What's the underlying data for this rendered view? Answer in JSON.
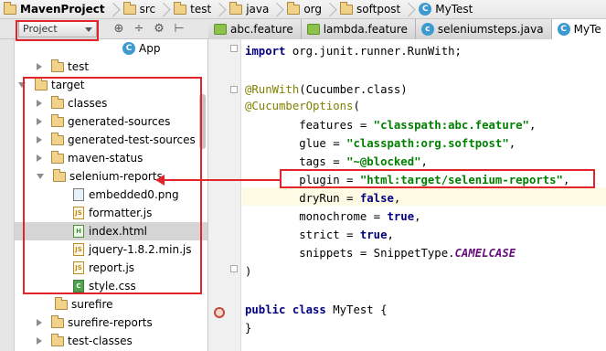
{
  "breadcrumbs": [
    {
      "label": "MavenProject",
      "icon": "folder-icon"
    },
    {
      "label": "src",
      "icon": "folder-icon"
    },
    {
      "label": "test",
      "icon": "folder-icon"
    },
    {
      "label": "java",
      "icon": "folder-icon"
    },
    {
      "label": "org",
      "icon": "folder-icon"
    },
    {
      "label": "softpost",
      "icon": "folder-icon"
    },
    {
      "label": "MyTest",
      "icon": "class-icon"
    }
  ],
  "project_panel": {
    "view_selector": "Project",
    "tool_icons": [
      "target-icon",
      "collapse-icon",
      "gear-icon",
      "hide-icon"
    ]
  },
  "tabs": [
    {
      "label": "abc.feature",
      "icon": "feature-icon"
    },
    {
      "label": "lambda.feature",
      "icon": "feature-icon"
    },
    {
      "label": "seleniumsteps.java",
      "icon": "class-icon"
    },
    {
      "label": "MyTe",
      "icon": "class-icon"
    }
  ],
  "tree": {
    "rows": [
      {
        "label": "App",
        "kind": "class"
      },
      {
        "label": "test",
        "kind": "folder"
      },
      {
        "label": "target",
        "kind": "folder-open"
      },
      {
        "label": "classes",
        "kind": "folder"
      },
      {
        "label": "generated-sources",
        "kind": "folder"
      },
      {
        "label": "generated-test-sources",
        "kind": "folder"
      },
      {
        "label": "maven-status",
        "kind": "folder"
      },
      {
        "label": "selenium-reports",
        "kind": "folder-open"
      },
      {
        "label": "embedded0.png",
        "kind": "png"
      },
      {
        "label": "formatter.js",
        "kind": "js"
      },
      {
        "label": "index.html",
        "kind": "html"
      },
      {
        "label": "jquery-1.8.2.min.js",
        "kind": "js"
      },
      {
        "label": "report.js",
        "kind": "js"
      },
      {
        "label": "style.css",
        "kind": "css"
      },
      {
        "label": "surefire",
        "kind": "folder"
      },
      {
        "label": "surefire-reports",
        "kind": "folder"
      },
      {
        "label": "test-classes",
        "kind": "folder"
      }
    ]
  },
  "code": {
    "import_kw": "import",
    "import_pkg": " org.junit.runner.RunWith;",
    "runwith_ann": "@RunWith",
    "runwith_arg": "(Cucumber.class)",
    "options_ann": "@CucumberOptions",
    "options_open": "(",
    "features_key": "        features = ",
    "features_val": "\"classpath:abc.feature\"",
    "features_end": ",",
    "glue_key": "        glue = ",
    "glue_val": "\"classpath:org.softpost\"",
    "glue_end": ",",
    "tags_key": "        tags = ",
    "tags_val": "\"~@blocked\"",
    "tags_end": ",",
    "plugin_key": "        plugin = ",
    "plugin_val": "\"html:target/selenium-reports\"",
    "plugin_end": ",",
    "dryrun_key": "        dryRun = ",
    "dryrun_val": "false",
    "dryrun_end": ",",
    "mono_key": "        monochrome = ",
    "mono_val": "true",
    "mono_end": ",",
    "strict_key": "        strict = ",
    "strict_val": "true",
    "strict_end": ",",
    "snip_key": "        snippets = SnippetType.",
    "snip_val": "CAMELCASE",
    "close_paren": ")",
    "class_kw": "public class",
    "class_name": " MyTest {",
    "close_brace": "}"
  },
  "colors": {
    "annotation_red": "#e1252b",
    "selection": "#d5d5d5",
    "keyword": "#000080",
    "string": "#008000",
    "annotation": "#808000"
  }
}
